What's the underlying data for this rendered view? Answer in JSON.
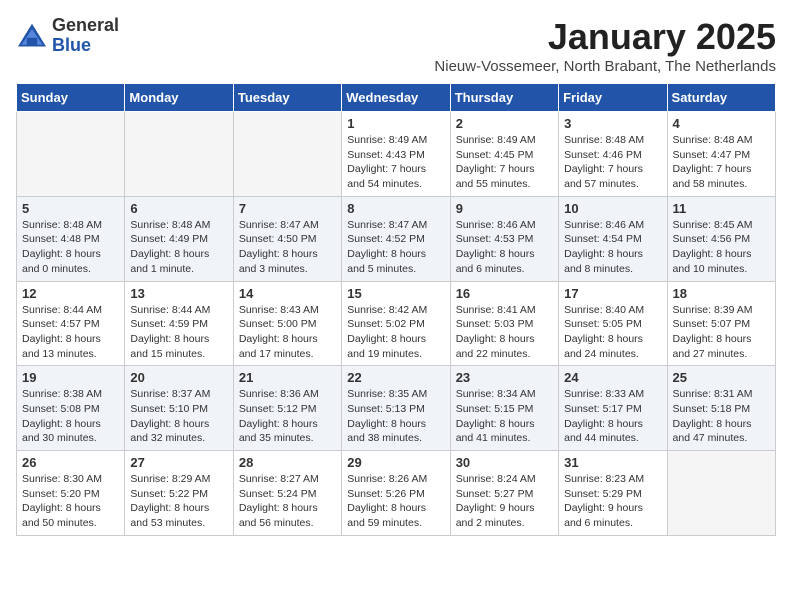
{
  "header": {
    "logo_general": "General",
    "logo_blue": "Blue",
    "title": "January 2025",
    "subtitle": "Nieuw-Vossemeer, North Brabant, The Netherlands"
  },
  "weekdays": [
    "Sunday",
    "Monday",
    "Tuesday",
    "Wednesday",
    "Thursday",
    "Friday",
    "Saturday"
  ],
  "weeks": [
    [
      {
        "day": "",
        "sunrise": "",
        "sunset": "",
        "daylight": ""
      },
      {
        "day": "",
        "sunrise": "",
        "sunset": "",
        "daylight": ""
      },
      {
        "day": "",
        "sunrise": "",
        "sunset": "",
        "daylight": ""
      },
      {
        "day": "1",
        "sunrise": "Sunrise: 8:49 AM",
        "sunset": "Sunset: 4:43 PM",
        "daylight": "Daylight: 7 hours and 54 minutes."
      },
      {
        "day": "2",
        "sunrise": "Sunrise: 8:49 AM",
        "sunset": "Sunset: 4:45 PM",
        "daylight": "Daylight: 7 hours and 55 minutes."
      },
      {
        "day": "3",
        "sunrise": "Sunrise: 8:48 AM",
        "sunset": "Sunset: 4:46 PM",
        "daylight": "Daylight: 7 hours and 57 minutes."
      },
      {
        "day": "4",
        "sunrise": "Sunrise: 8:48 AM",
        "sunset": "Sunset: 4:47 PM",
        "daylight": "Daylight: 7 hours and 58 minutes."
      }
    ],
    [
      {
        "day": "5",
        "sunrise": "Sunrise: 8:48 AM",
        "sunset": "Sunset: 4:48 PM",
        "daylight": "Daylight: 8 hours and 0 minutes."
      },
      {
        "day": "6",
        "sunrise": "Sunrise: 8:48 AM",
        "sunset": "Sunset: 4:49 PM",
        "daylight": "Daylight: 8 hours and 1 minute."
      },
      {
        "day": "7",
        "sunrise": "Sunrise: 8:47 AM",
        "sunset": "Sunset: 4:50 PM",
        "daylight": "Daylight: 8 hours and 3 minutes."
      },
      {
        "day": "8",
        "sunrise": "Sunrise: 8:47 AM",
        "sunset": "Sunset: 4:52 PM",
        "daylight": "Daylight: 8 hours and 5 minutes."
      },
      {
        "day": "9",
        "sunrise": "Sunrise: 8:46 AM",
        "sunset": "Sunset: 4:53 PM",
        "daylight": "Daylight: 8 hours and 6 minutes."
      },
      {
        "day": "10",
        "sunrise": "Sunrise: 8:46 AM",
        "sunset": "Sunset: 4:54 PM",
        "daylight": "Daylight: 8 hours and 8 minutes."
      },
      {
        "day": "11",
        "sunrise": "Sunrise: 8:45 AM",
        "sunset": "Sunset: 4:56 PM",
        "daylight": "Daylight: 8 hours and 10 minutes."
      }
    ],
    [
      {
        "day": "12",
        "sunrise": "Sunrise: 8:44 AM",
        "sunset": "Sunset: 4:57 PM",
        "daylight": "Daylight: 8 hours and 13 minutes."
      },
      {
        "day": "13",
        "sunrise": "Sunrise: 8:44 AM",
        "sunset": "Sunset: 4:59 PM",
        "daylight": "Daylight: 8 hours and 15 minutes."
      },
      {
        "day": "14",
        "sunrise": "Sunrise: 8:43 AM",
        "sunset": "Sunset: 5:00 PM",
        "daylight": "Daylight: 8 hours and 17 minutes."
      },
      {
        "day": "15",
        "sunrise": "Sunrise: 8:42 AM",
        "sunset": "Sunset: 5:02 PM",
        "daylight": "Daylight: 8 hours and 19 minutes."
      },
      {
        "day": "16",
        "sunrise": "Sunrise: 8:41 AM",
        "sunset": "Sunset: 5:03 PM",
        "daylight": "Daylight: 8 hours and 22 minutes."
      },
      {
        "day": "17",
        "sunrise": "Sunrise: 8:40 AM",
        "sunset": "Sunset: 5:05 PM",
        "daylight": "Daylight: 8 hours and 24 minutes."
      },
      {
        "day": "18",
        "sunrise": "Sunrise: 8:39 AM",
        "sunset": "Sunset: 5:07 PM",
        "daylight": "Daylight: 8 hours and 27 minutes."
      }
    ],
    [
      {
        "day": "19",
        "sunrise": "Sunrise: 8:38 AM",
        "sunset": "Sunset: 5:08 PM",
        "daylight": "Daylight: 8 hours and 30 minutes."
      },
      {
        "day": "20",
        "sunrise": "Sunrise: 8:37 AM",
        "sunset": "Sunset: 5:10 PM",
        "daylight": "Daylight: 8 hours and 32 minutes."
      },
      {
        "day": "21",
        "sunrise": "Sunrise: 8:36 AM",
        "sunset": "Sunset: 5:12 PM",
        "daylight": "Daylight: 8 hours and 35 minutes."
      },
      {
        "day": "22",
        "sunrise": "Sunrise: 8:35 AM",
        "sunset": "Sunset: 5:13 PM",
        "daylight": "Daylight: 8 hours and 38 minutes."
      },
      {
        "day": "23",
        "sunrise": "Sunrise: 8:34 AM",
        "sunset": "Sunset: 5:15 PM",
        "daylight": "Daylight: 8 hours and 41 minutes."
      },
      {
        "day": "24",
        "sunrise": "Sunrise: 8:33 AM",
        "sunset": "Sunset: 5:17 PM",
        "daylight": "Daylight: 8 hours and 44 minutes."
      },
      {
        "day": "25",
        "sunrise": "Sunrise: 8:31 AM",
        "sunset": "Sunset: 5:18 PM",
        "daylight": "Daylight: 8 hours and 47 minutes."
      }
    ],
    [
      {
        "day": "26",
        "sunrise": "Sunrise: 8:30 AM",
        "sunset": "Sunset: 5:20 PM",
        "daylight": "Daylight: 8 hours and 50 minutes."
      },
      {
        "day": "27",
        "sunrise": "Sunrise: 8:29 AM",
        "sunset": "Sunset: 5:22 PM",
        "daylight": "Daylight: 8 hours and 53 minutes."
      },
      {
        "day": "28",
        "sunrise": "Sunrise: 8:27 AM",
        "sunset": "Sunset: 5:24 PM",
        "daylight": "Daylight: 8 hours and 56 minutes."
      },
      {
        "day": "29",
        "sunrise": "Sunrise: 8:26 AM",
        "sunset": "Sunset: 5:26 PM",
        "daylight": "Daylight: 8 hours and 59 minutes."
      },
      {
        "day": "30",
        "sunrise": "Sunrise: 8:24 AM",
        "sunset": "Sunset: 5:27 PM",
        "daylight": "Daylight: 9 hours and 2 minutes."
      },
      {
        "day": "31",
        "sunrise": "Sunrise: 8:23 AM",
        "sunset": "Sunset: 5:29 PM",
        "daylight": "Daylight: 9 hours and 6 minutes."
      },
      {
        "day": "",
        "sunrise": "",
        "sunset": "",
        "daylight": ""
      }
    ]
  ]
}
